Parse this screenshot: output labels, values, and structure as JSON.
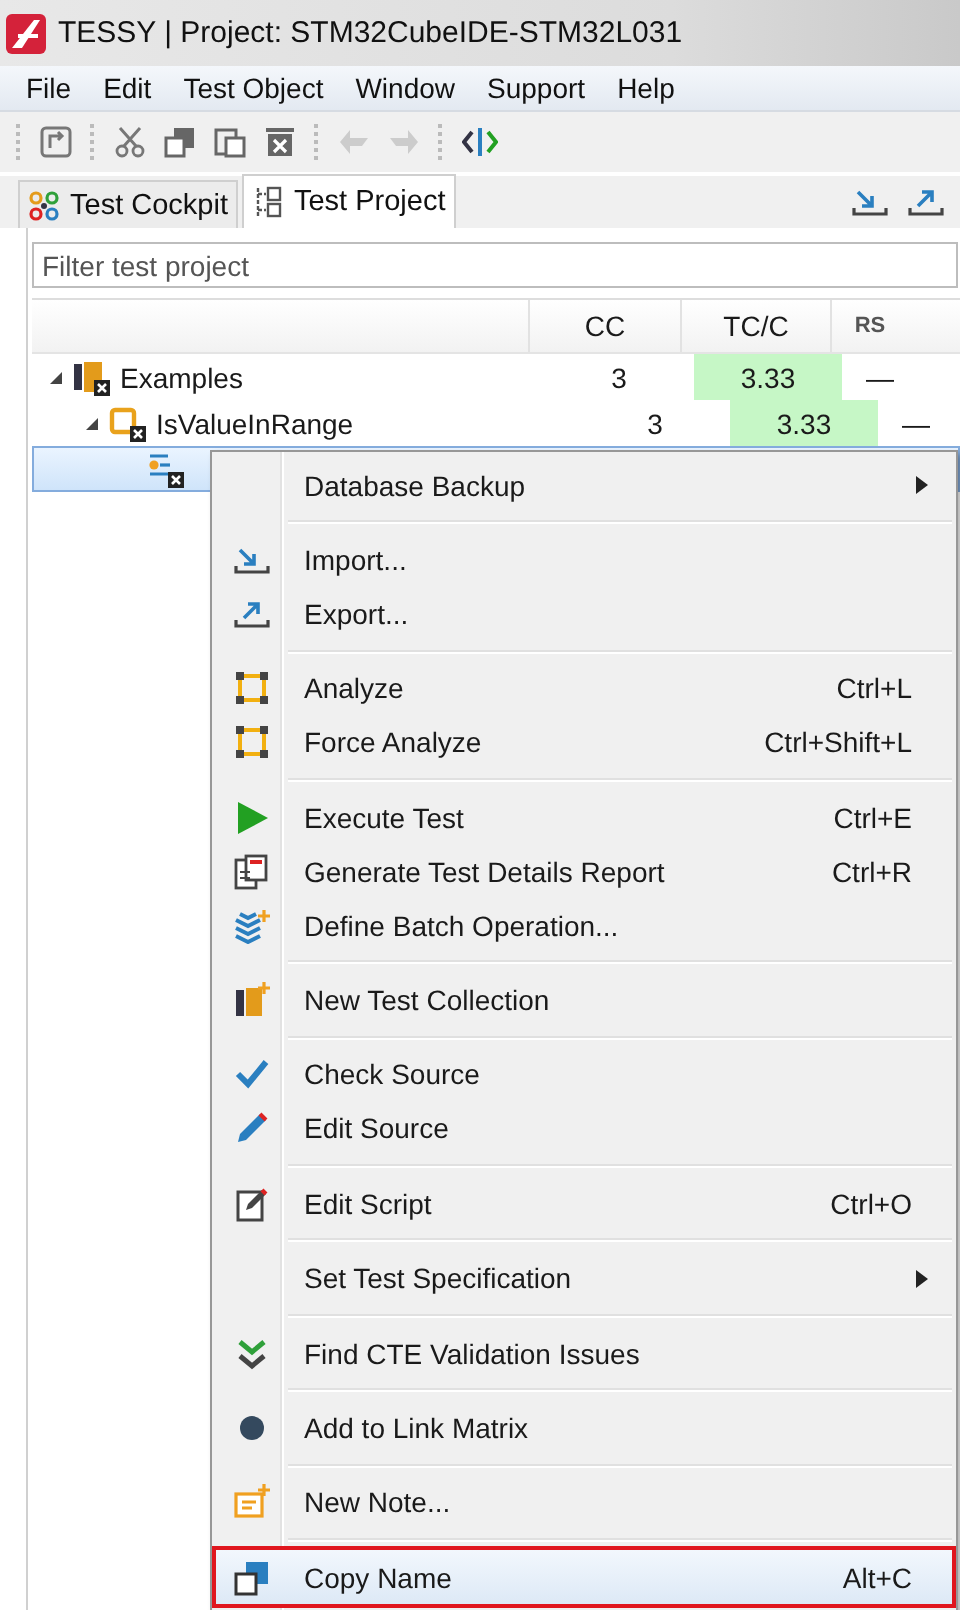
{
  "window": {
    "title": "TESSY | Project: STM32CubeIDE-STM32L031"
  },
  "menu_bar": [
    "File",
    "Edit",
    "Test Object",
    "Window",
    "Support",
    "Help"
  ],
  "tabs": [
    {
      "label": "Test Cockpit",
      "selected": false
    },
    {
      "label": "Test Project",
      "selected": true
    }
  ],
  "filter": {
    "placeholder": "Filter test project"
  },
  "table": {
    "columns": [
      "CC",
      "TC/C",
      "RS"
    ],
    "rows": [
      {
        "label": "Examples",
        "expanded": true,
        "selected": false,
        "cells": [
          "3",
          "3.33",
          "—"
        ],
        "children": [
          {
            "label": "IsValueInRange",
            "expanded": true,
            "selected": false,
            "cells": [
              "3",
              "3.33",
              "—"
            ],
            "children": [
              {
                "selected": true
              }
            ]
          }
        ]
      }
    ]
  },
  "context_menu": {
    "groups": [
      [
        {
          "label": "Database Backup",
          "submenu": true,
          "selected": false
        }
      ],
      [
        {
          "label": "Import...",
          "selected": false
        },
        {
          "label": "Export...",
          "selected": false
        }
      ],
      [
        {
          "label": "Analyze",
          "shortcut": "Ctrl+L",
          "selected": false
        },
        {
          "label": "Force Analyze",
          "shortcut": "Ctrl+Shift+L",
          "selected": false
        }
      ],
      [
        {
          "label": "Execute Test",
          "shortcut": "Ctrl+E",
          "selected": false
        },
        {
          "label": "Generate Test Details Report",
          "shortcut": "Ctrl+R",
          "selected": false
        },
        {
          "label": "Define Batch Operation...",
          "selected": false
        }
      ],
      [
        {
          "label": "New Test Collection",
          "selected": false
        }
      ],
      [
        {
          "label": "Check Source",
          "selected": false
        },
        {
          "label": "Edit Source",
          "selected": false
        }
      ],
      [
        {
          "label": "Edit Script",
          "shortcut": "Ctrl+O",
          "selected": false
        }
      ],
      [
        {
          "label": "Set Test Specification",
          "submenu": true,
          "selected": false
        }
      ],
      [
        {
          "label": "Find CTE Validation Issues",
          "selected": false
        }
      ],
      [
        {
          "label": "Add to Link Matrix",
          "selected": false
        }
      ],
      [
        {
          "label": "New Note...",
          "selected": false
        }
      ],
      [
        {
          "label": "Copy Name",
          "shortcut": "Alt+C",
          "selected": true
        }
      ]
    ]
  }
}
